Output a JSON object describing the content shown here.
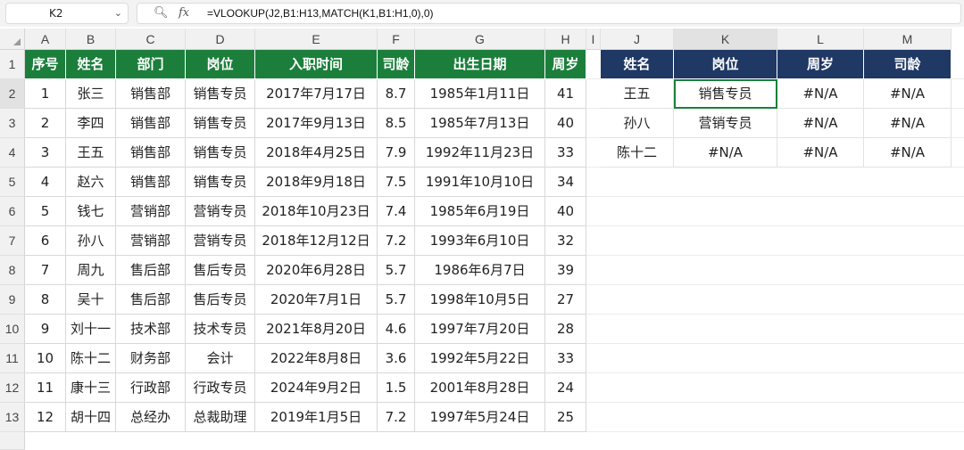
{
  "formula_bar": {
    "name_box": "K2",
    "zoom_icon": "zoom-icon",
    "fx_label": "fx",
    "formula": "=VLOOKUP(J2,B1:H13,MATCH(K1,B1:H1,0),0)"
  },
  "columns": [
    "A",
    "B",
    "C",
    "D",
    "E",
    "F",
    "G",
    "H",
    "I",
    "J",
    "K",
    "L",
    "M"
  ],
  "rows": [
    "1",
    "2",
    "3",
    "4",
    "5",
    "6",
    "7",
    "8",
    "9",
    "10",
    "11",
    "12",
    "13"
  ],
  "main_table": {
    "headers": [
      "序号",
      "姓名",
      "部门",
      "岗位",
      "入职时间",
      "司龄",
      "出生日期",
      "周岁"
    ],
    "rows": [
      [
        "1",
        "张三",
        "销售部",
        "销售专员",
        "2017年7月17日",
        "8.7",
        "1985年1月11日",
        "41"
      ],
      [
        "2",
        "李四",
        "销售部",
        "销售专员",
        "2017年9月13日",
        "8.5",
        "1985年7月13日",
        "40"
      ],
      [
        "3",
        "王五",
        "销售部",
        "销售专员",
        "2018年4月25日",
        "7.9",
        "1992年11月23日",
        "33"
      ],
      [
        "4",
        "赵六",
        "销售部",
        "销售专员",
        "2018年9月18日",
        "7.5",
        "1991年10月10日",
        "34"
      ],
      [
        "5",
        "钱七",
        "营销部",
        "营销专员",
        "2018年10月23日",
        "7.4",
        "1985年6月19日",
        "40"
      ],
      [
        "6",
        "孙八",
        "营销部",
        "营销专员",
        "2018年12月12日",
        "7.2",
        "1993年6月10日",
        "32"
      ],
      [
        "7",
        "周九",
        "售后部",
        "售后专员",
        "2020年6月28日",
        "5.7",
        "1986年6月7日",
        "39"
      ],
      [
        "8",
        "吴十",
        "售后部",
        "售后专员",
        "2020年7月1日",
        "5.7",
        "1998年10月5日",
        "27"
      ],
      [
        "9",
        "刘十一",
        "技术部",
        "技术专员",
        "2021年8月20日",
        "4.6",
        "1997年7月20日",
        "28"
      ],
      [
        "10",
        "陈十二",
        "财务部",
        "会计",
        "2022年8月8日",
        "3.6",
        "1992年5月22日",
        "33"
      ],
      [
        "11",
        "康十三",
        "行政部",
        "行政专员",
        "2024年9月2日",
        "1.5",
        "2001年8月28日",
        "24"
      ],
      [
        "12",
        "胡十四",
        "总经办",
        "总裁助理",
        "2019年1月5日",
        "7.2",
        "1997年5月24日",
        "25"
      ]
    ]
  },
  "lookup_table": {
    "headers": [
      "姓名",
      "岗位",
      "周岁",
      "司龄"
    ],
    "rows": [
      [
        "王五",
        "销售专员",
        "#N/A",
        "#N/A"
      ],
      [
        "孙八",
        "营销专员",
        "#N/A",
        "#N/A"
      ],
      [
        "陈十二",
        "#N/A",
        "#N/A",
        "#N/A"
      ]
    ]
  },
  "colors": {
    "main_header_bg": "#1b7f3b",
    "lookup_header_bg": "#1f3864",
    "active_cell_border": "#1b7f3b"
  }
}
